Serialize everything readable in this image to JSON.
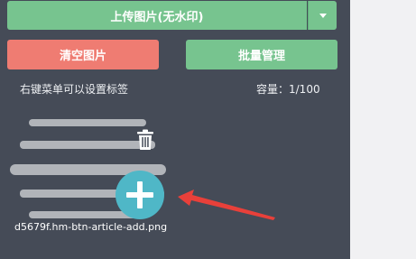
{
  "toolbar": {
    "upload_label": "上传图片(无水印)",
    "clear_label": "清空图片",
    "batch_label": "批量管理"
  },
  "info": {
    "hint": "右键菜单可以设置标签",
    "capacity": "容量：1/100"
  },
  "image_item": {
    "filename": "d5679f.hm-btn-article-add.png",
    "delete_icon": "trash-icon",
    "preview_icon": "plus-icon"
  },
  "colors": {
    "panel_bg": "#454b57",
    "upload_green": "#77c48f",
    "clear_red": "#ef7c72",
    "plus_blue": "#4fb7c7",
    "arrow_red": "#e8403a"
  }
}
